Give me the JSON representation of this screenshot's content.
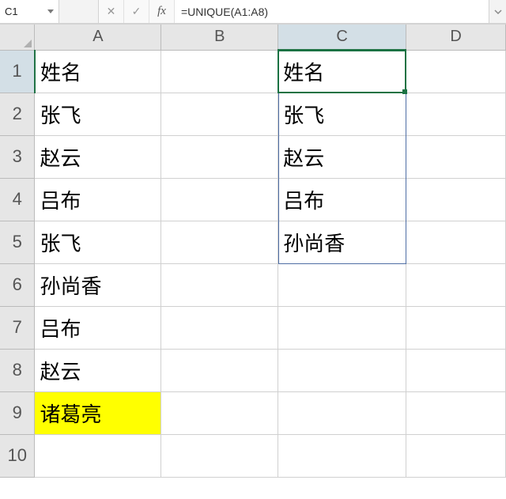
{
  "formula_bar": {
    "cell_ref": "C1",
    "cancel_glyph": "✕",
    "confirm_glyph": "✓",
    "fx_glyph": "fx",
    "formula_text": "=UNIQUE(A1:A8)"
  },
  "columns": [
    "A",
    "B",
    "C",
    "D"
  ],
  "rows": [
    "1",
    "2",
    "3",
    "4",
    "5",
    "6",
    "7",
    "8",
    "9",
    "10"
  ],
  "selected_col_index": 2,
  "selected_row_index": 0,
  "cells": {
    "A1": "姓名",
    "A2": "张飞",
    "A3": "赵云",
    "A4": "吕布",
    "A5": "张飞",
    "A6": "孙尚香",
    "A7": "吕布",
    "A8": "赵云",
    "A9": "诸葛亮",
    "C1": "姓名",
    "C2": "张飞",
    "C3": "赵云",
    "C4": "吕布",
    "C5": "孙尚香"
  },
  "highlight_yellow": [
    "A9"
  ],
  "active_cell": {
    "col": 2,
    "row": 0
  },
  "spill_range": {
    "col": 2,
    "row_start": 0,
    "row_end": 4
  },
  "chart_data": {
    "type": "table",
    "note": "Column C = UNIQUE(A1:A8)",
    "columns": {
      "A_source": [
        "姓名",
        "张飞",
        "赵云",
        "吕布",
        "张飞",
        "孙尚香",
        "吕布",
        "赵云",
        "诸葛亮"
      ],
      "C_unique_result": [
        "姓名",
        "张飞",
        "赵云",
        "吕布",
        "孙尚香"
      ]
    }
  }
}
